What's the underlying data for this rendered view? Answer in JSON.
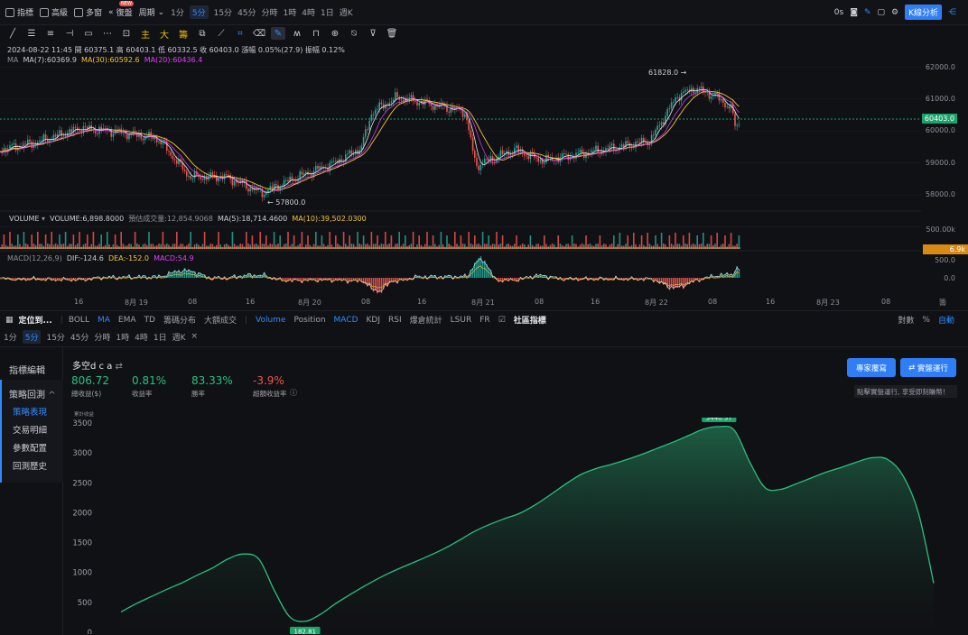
{
  "topbar": {
    "indicators": "指標",
    "advanced": "高級",
    "multi": "多窗",
    "replay": "復盤",
    "replay_badge": "NEW",
    "period": "周期",
    "intervals": [
      "1分",
      "5分",
      "15分",
      "45分",
      "分時",
      "1時",
      "4時",
      "1日",
      "週K"
    ],
    "active_interval": "5分",
    "latency": "0s",
    "kline_analysis": "K線分析"
  },
  "drawtools": {
    "main": "主",
    "big": "大",
    "chips": "籌"
  },
  "chart": {
    "ohlc_line": "2024-08-22 11:45  開 60375.1  高 60403.1  低 60332.5  收 60403.0  漲幅 0.05%(27.9)  振幅 0.12%",
    "ma_label": "MA",
    "ma7": "MA(7):60369.9",
    "ma30": "MA(30):60592.6",
    "ma20": "MA(20):60436.4",
    "high_annotation": "61828.0 →",
    "low_annotation": "← 57800.0",
    "current_price": "60403.0",
    "price_ticks": [
      "62000.0",
      "61000.0",
      "60000.0",
      "59000.0",
      "58000.0"
    ],
    "volume_label": "VOLUME",
    "volume_line": "VOLUME:6,898.8000",
    "volume_est": "預估成交量:12,854.9068",
    "volume_ma5": "MA(5):18,714.4600",
    "volume_ma10": "MA(10):39,502.0300",
    "volume_tick": "500.00k",
    "volume_current": "6.9k",
    "macd_label": "MACD(12,26,9)",
    "macd_dif": "DIF:-124.6",
    "macd_dea": "DEA:-152.0",
    "macd_val": "MACD:54.9",
    "macd_ticks": [
      "500.0",
      "0.0"
    ],
    "x_labels": [
      "16",
      "8月 19",
      "08",
      "16",
      "8月 20",
      "08",
      "16",
      "8月 21",
      "08",
      "16",
      "8月 22",
      "08",
      "16",
      "8月 23",
      "08",
      "籌"
    ],
    "colors": {
      "up": "#26a69a",
      "down": "#ef5350",
      "ma7": "#e6e8ec",
      "ma30": "#f0c23b",
      "ma20": "#e040fb"
    }
  },
  "indbar": {
    "position_btn": "定位到...",
    "items": [
      "BOLL",
      "MA",
      "EMA",
      "TD",
      "籌碼分布",
      "大額成交",
      "Volume",
      "Position",
      "MACD",
      "KDJ",
      "RSI",
      "爆倉統計",
      "LSUR",
      "FR"
    ],
    "active": [
      "MA",
      "Volume",
      "MACD"
    ],
    "community": "社區指標",
    "log": "對數",
    "percent": "%",
    "auto": "自動"
  },
  "intbar2": {
    "intervals": [
      "1分",
      "5分",
      "15分",
      "45分",
      "分時",
      "1時",
      "4時",
      "1日",
      "週K"
    ],
    "active": "5分",
    "close": "×"
  },
  "panel": {
    "nav": {
      "edit": "指標編輯",
      "backtest": "策略回測",
      "items": [
        "策略表現",
        "交易明細",
        "參數配置",
        "回測歷史"
      ],
      "active": "策略表現"
    },
    "strategy_name": "多空d c a",
    "stats": [
      {
        "value": "806.72",
        "label": "總收益($)",
        "color": "#26c281"
      },
      {
        "value": "0.81%",
        "label": "收益率",
        "color": "#26c281"
      },
      {
        "value": "83.33%",
        "label": "勝率",
        "color": "#26c281"
      },
      {
        "value": "-3.9%",
        "label": "超額收益率",
        "color": "#ef5350"
      }
    ],
    "expert_review": "專家覆寫",
    "live_run": "實盤運行",
    "hint": "點擊實盤運行, 享受即刻賺幣！",
    "equity_axis_label": "累計收益",
    "y_ticks": [
      "3500",
      "3000",
      "2500",
      "2000",
      "1500",
      "1000",
      "500",
      "0"
    ],
    "peak_label": "3440.37",
    "trough_label": "182.81"
  },
  "chart_data": {
    "type": "area",
    "title": "",
    "ylabel": "累計收益",
    "ylim": [
      0,
      3500
    ],
    "series": [
      {
        "values": [
          340,
          480,
          600,
          720,
          830,
          960,
          1080,
          1230,
          1310,
          1220,
          700,
          260,
          182.81,
          300,
          480,
          640,
          790,
          930,
          1050,
          1160,
          1270,
          1390,
          1530,
          1680,
          1800,
          1900,
          1990,
          2130,
          2300,
          2480,
          2640,
          2740,
          2810,
          2890,
          2980,
          3080,
          3180,
          3290,
          3400,
          3440.37,
          3380,
          2850,
          2420,
          2390,
          2480,
          2580,
          2680,
          2760,
          2850,
          2920,
          2890,
          2620,
          2000,
          820
        ]
      }
    ]
  }
}
